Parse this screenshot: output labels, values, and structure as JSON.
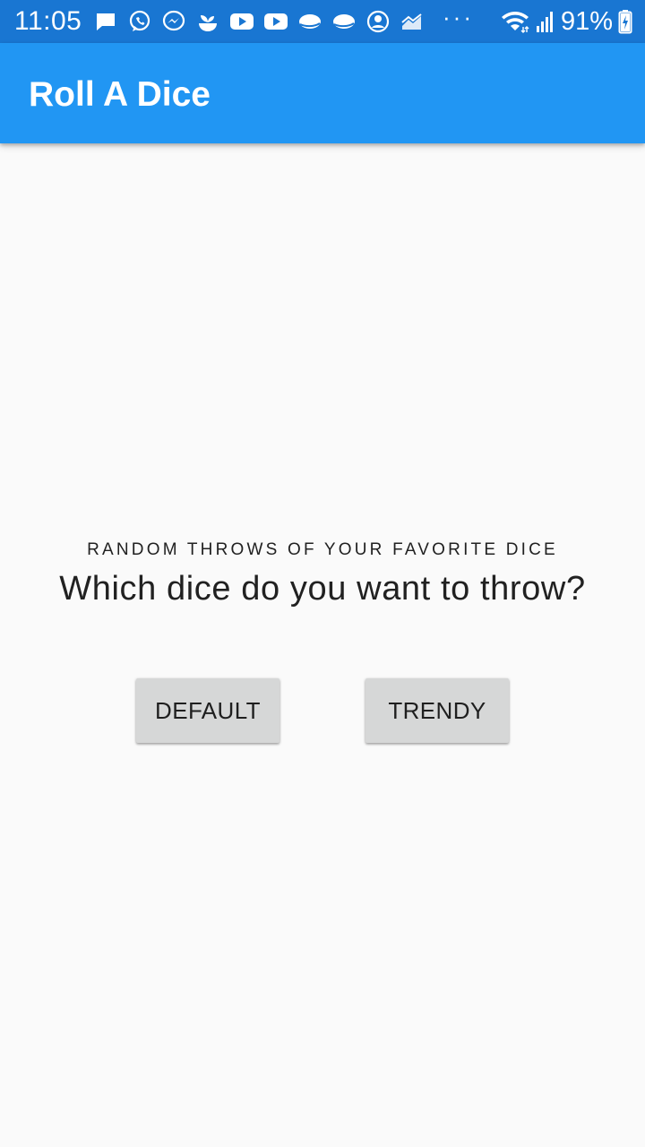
{
  "status_bar": {
    "time": "11:05",
    "notification_icons": [
      "message-icon",
      "whatsapp-icon",
      "messenger-icon",
      "sprout-icon",
      "youtube-icon",
      "youtube-icon",
      "planet-icon",
      "planet-icon",
      "account-icon",
      "chart-icon"
    ],
    "more_indicator": "···",
    "wifi_icon": "wifi-icon",
    "signal_icon": "signal-icon",
    "battery_percent": "91%",
    "battery_icon": "battery-charging-icon"
  },
  "app_bar": {
    "title": "Roll A Dice"
  },
  "main": {
    "subtitle": "RANDOM THROWS OF YOUR FAVORITE DICE",
    "question": "Which dice do you want to throw?",
    "buttons": [
      {
        "label": "DEFAULT"
      },
      {
        "label": "TRENDY"
      }
    ]
  },
  "colors": {
    "status_bar": "#1976d2",
    "app_bar": "#2196f3",
    "background": "#fafafa",
    "button": "#d6d7d7",
    "text": "#212121"
  }
}
